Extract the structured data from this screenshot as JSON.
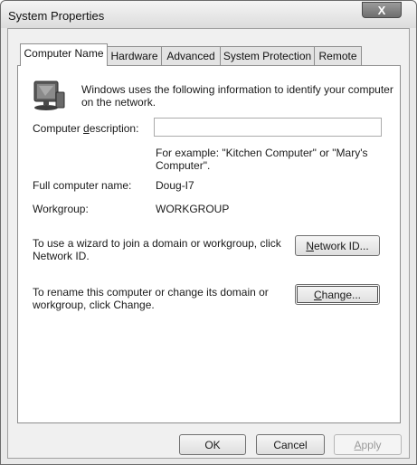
{
  "window": {
    "title": "System Properties",
    "close_glyph": "X"
  },
  "tabs": [
    {
      "label": "Computer Name"
    },
    {
      "label": "Hardware"
    },
    {
      "label": "Advanced"
    },
    {
      "label": "System Protection"
    },
    {
      "label": "Remote"
    }
  ],
  "computer_name": {
    "intro_line1": "Windows uses the following information to identify your computer",
    "intro_line2": "on the network.",
    "description_label_pre": "Computer ",
    "description_label_key": "d",
    "description_label_post": "escription:",
    "description_value": "",
    "example_line1": "For example: \"Kitchen Computer\" or \"Mary's",
    "example_line2": "Computer\".",
    "full_name_label": "Full computer name:",
    "full_name_value": "Doug-I7",
    "workgroup_label": "Workgroup:",
    "workgroup_value": "WORKGROUP",
    "network_text_line1": "To use a wizard to join a domain or workgroup, click",
    "network_text_line2": "Network ID.",
    "network_btn_key": "N",
    "network_btn_rest": "etwork ID...",
    "rename_text_line1": "To rename this computer or change its domain or",
    "rename_text_line2": "workgroup, click Change.",
    "change_btn_key": "C",
    "change_btn_rest": "hange..."
  },
  "footer": {
    "ok_label": "OK",
    "cancel_label": "Cancel",
    "apply_key": "A",
    "apply_rest": "pply"
  },
  "icons": {
    "computer": "computer-monitor-icon",
    "close": "close-icon"
  }
}
